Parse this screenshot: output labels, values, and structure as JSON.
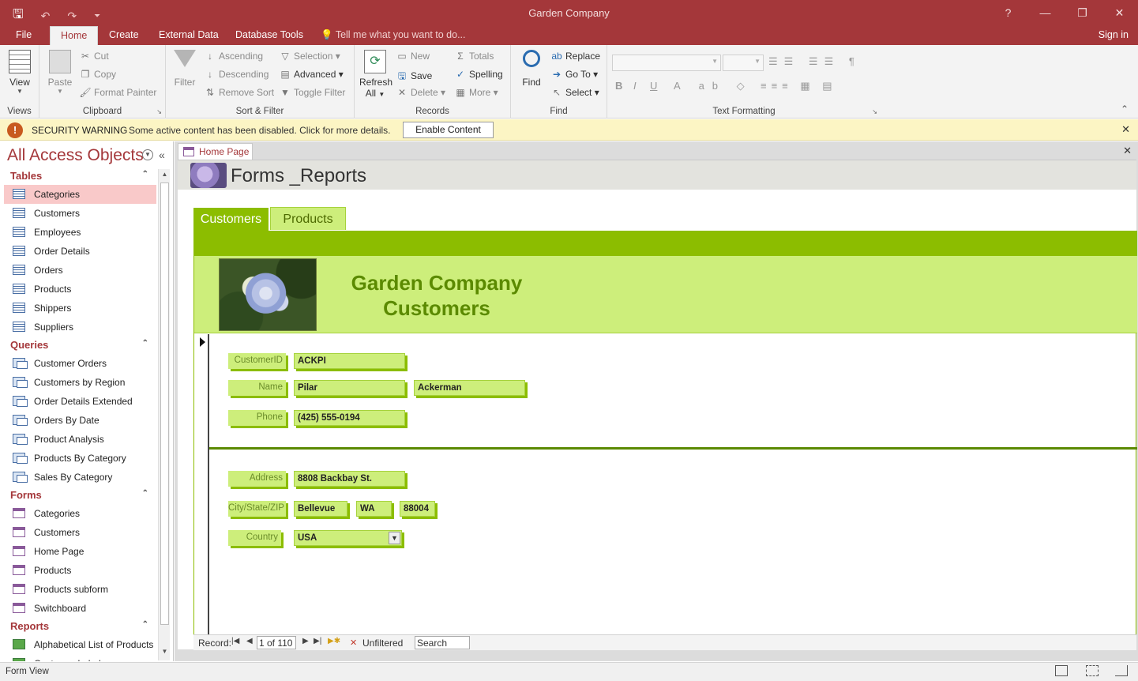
{
  "window": {
    "title": "Garden Company"
  },
  "qat": {
    "save": "🖫",
    "undo": "↶",
    "redo": "↷",
    "customize": "⏷"
  },
  "window_controls": {
    "help": "?",
    "minimize": "—",
    "restore": "❐",
    "close": "✕"
  },
  "ribbon_tabs": [
    "File",
    "Home",
    "Create",
    "External Data",
    "Database Tools"
  ],
  "tell_me": "Tell me what you want to do...",
  "sign_in": "Sign in",
  "ribbon": {
    "views": {
      "view": "View",
      "label": "Views"
    },
    "clipboard": {
      "paste": "Paste",
      "cut": "Cut",
      "copy": "Copy",
      "format_painter": "Format Painter",
      "label": "Clipboard"
    },
    "sort_filter": {
      "filter": "Filter",
      "ascending": "Ascending",
      "descending": "Descending",
      "remove_sort": "Remove Sort",
      "selection": "Selection",
      "advanced": "Advanced",
      "toggle_filter": "Toggle Filter",
      "label": "Sort & Filter"
    },
    "records": {
      "refresh": "Refresh",
      "refresh_all": "All",
      "new": "New",
      "save": "Save",
      "delete": "Delete",
      "totals": "Totals",
      "spelling": "Spelling",
      "more": "More",
      "label": "Records"
    },
    "find": {
      "find": "Find",
      "replace": "Replace",
      "goto": "Go To",
      "select": "Select",
      "label": "Find"
    },
    "text_formatting": {
      "label": "Text Formatting",
      "bold": "B",
      "italic": "I",
      "underline": "U"
    }
  },
  "security": {
    "title": "SECURITY WARNING",
    "message": "Some active content has been disabled. Click for more details.",
    "button": "Enable Content"
  },
  "nav": {
    "title": "All Access Objects",
    "sections": [
      {
        "name": "Tables",
        "icon": "table",
        "items": [
          "Categories",
          "Customers",
          "Employees",
          "Order Details",
          "Orders",
          "Products",
          "Shippers",
          "Suppliers"
        ]
      },
      {
        "name": "Queries",
        "icon": "query",
        "items": [
          "Customer Orders",
          "Customers by Region",
          "Order Details Extended",
          "Orders By Date",
          "Product Analysis",
          "Products By Category",
          "Sales By Category"
        ]
      },
      {
        "name": "Forms",
        "icon": "form",
        "items": [
          "Categories",
          "Customers",
          "Home Page",
          "Products",
          "Products subform",
          "Switchboard"
        ]
      },
      {
        "name": "Reports",
        "icon": "report",
        "items": [
          "Alphabetical List of Products",
          "Customer Labels"
        ]
      }
    ],
    "selected": "Categories"
  },
  "document": {
    "tab": "Home Page",
    "form_title": "Forms _Reports",
    "subtabs": [
      "Customers",
      "Products"
    ],
    "heading_line1": "Garden Company",
    "heading_line2": "Customers",
    "fields": {
      "customer_id_label": "CustomerID",
      "customer_id": "ACKPI",
      "name_label": "Name",
      "first_name": "Pilar",
      "last_name": "Ackerman",
      "phone_label": "Phone",
      "phone": "(425) 555-0194",
      "address_label": "Address",
      "address": "8808 Backbay St.",
      "csz_label": "City/State/ZIP",
      "city": "Bellevue",
      "state": "WA",
      "zip": "88004",
      "country_label": "Country",
      "country": "USA"
    },
    "record_nav": {
      "label": "Record:",
      "position": "1 of 110",
      "filter": "Unfiltered",
      "search": "Search"
    }
  },
  "status": {
    "view": "Form View"
  }
}
